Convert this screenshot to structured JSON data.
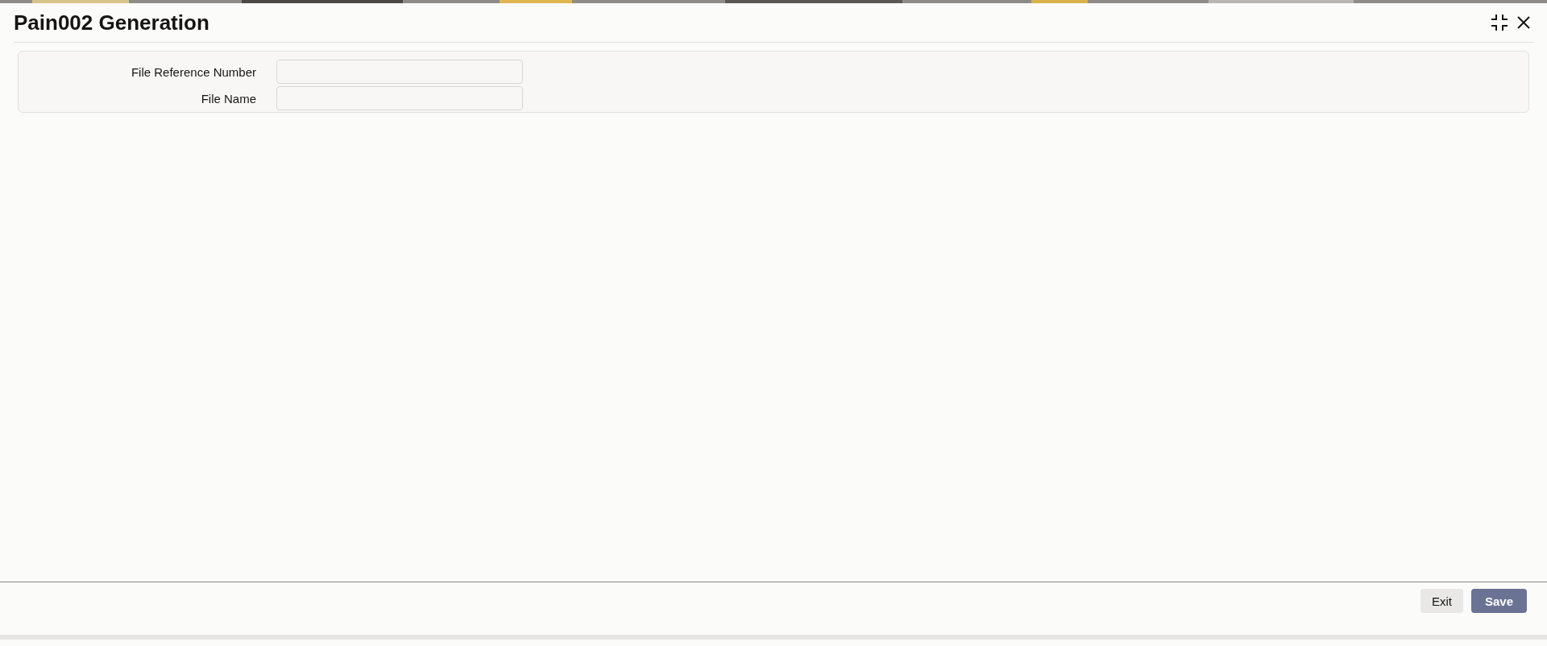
{
  "window": {
    "title": "Pain002 Generation"
  },
  "form": {
    "fields": [
      {
        "label": "File Reference Number"
      },
      {
        "label": "File Name"
      }
    ]
  },
  "buttons": [
    {
      "label": "Exit",
      "kind": "secondary"
    },
    {
      "label": "Save",
      "kind": "primary"
    }
  ]
}
